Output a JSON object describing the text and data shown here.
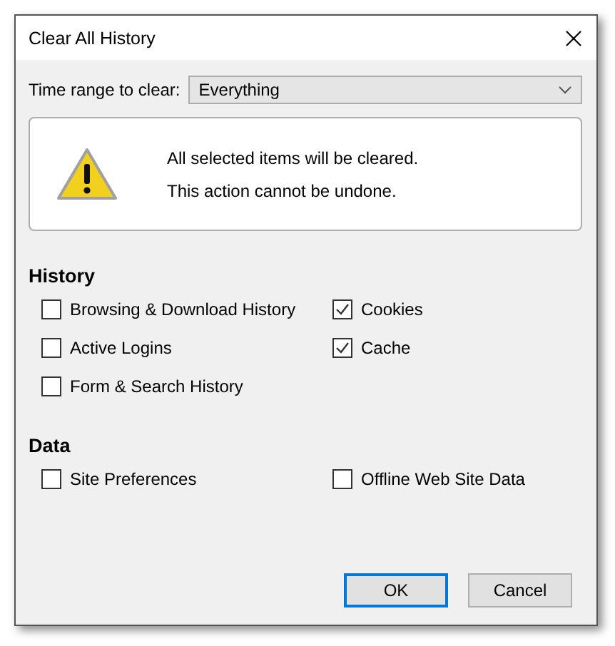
{
  "window": {
    "title": "Clear All History"
  },
  "time_range": {
    "label": "Time range to clear:",
    "value": "Everything"
  },
  "warning": {
    "lines": [
      "All selected items will be cleared.",
      "This action cannot be undone."
    ]
  },
  "sections": [
    {
      "heading": "History",
      "items": [
        {
          "label": "Browsing & Download History",
          "checked": false
        },
        {
          "label": "Cookies",
          "checked": true
        },
        {
          "label": "Active Logins",
          "checked": false
        },
        {
          "label": "Cache",
          "checked": true
        },
        {
          "label": "Form & Search History",
          "checked": false
        }
      ]
    },
    {
      "heading": "Data",
      "items": [
        {
          "label": "Site Preferences",
          "checked": false
        },
        {
          "label": "Offline Web Site Data",
          "checked": false
        }
      ]
    }
  ],
  "buttons": [
    {
      "label": "OK",
      "default": true
    },
    {
      "label": "Cancel",
      "default": false
    }
  ]
}
